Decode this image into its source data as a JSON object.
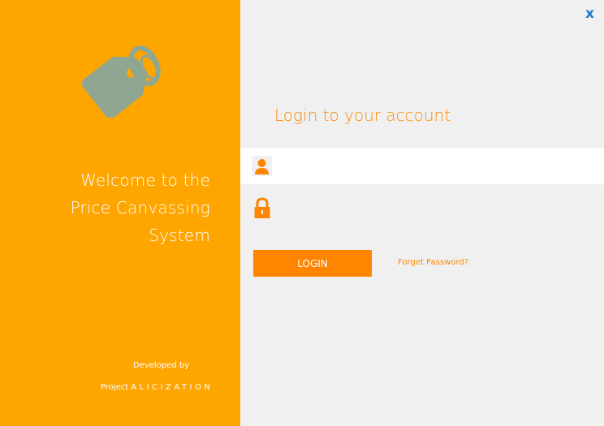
{
  "welcome": {
    "line1": "Welcome to the",
    "line2": "Price Canvassing",
    "line3": "System"
  },
  "footer": {
    "developed_by": "Developed by",
    "project_label": "Project",
    "project_name": "ALICIZATION"
  },
  "header": {
    "close_label": "x"
  },
  "login": {
    "title": "Login to your account",
    "username_value": "",
    "password_value": "",
    "button_label": "LOGIN",
    "forgot_label": "Forget Password?"
  },
  "colors": {
    "sidebar": "#ffa500",
    "accent": "#ff8500",
    "logo": "#8fa690",
    "close": "#1e78c8"
  },
  "icons": {
    "logo": "price-tag-icon",
    "user": "user-icon",
    "password": "lock-icon",
    "close": "close-icon"
  }
}
